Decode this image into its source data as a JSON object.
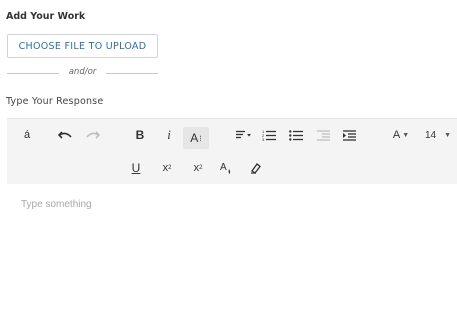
{
  "heading": "Add Your Work",
  "upload_button": "CHOOSE FILE TO UPLOAD",
  "divider_text": "and/or",
  "response_label": "Type Your Response",
  "toolbar": {
    "special_char": "á",
    "bold": "B",
    "italic": "i",
    "font_style": "A",
    "text_color": "A",
    "font_size": "14",
    "underline": "U",
    "subscript": "x",
    "subscript_mark": "2",
    "superscript": "x",
    "superscript_mark": "2",
    "icons": [
      "undo-icon",
      "redo-icon",
      "align-icon",
      "ordered-list-icon",
      "bullet-list-icon",
      "outdent-icon",
      "indent-icon",
      "fill-color-icon",
      "clear-format-icon"
    ]
  },
  "editor": {
    "placeholder": "Type something"
  }
}
